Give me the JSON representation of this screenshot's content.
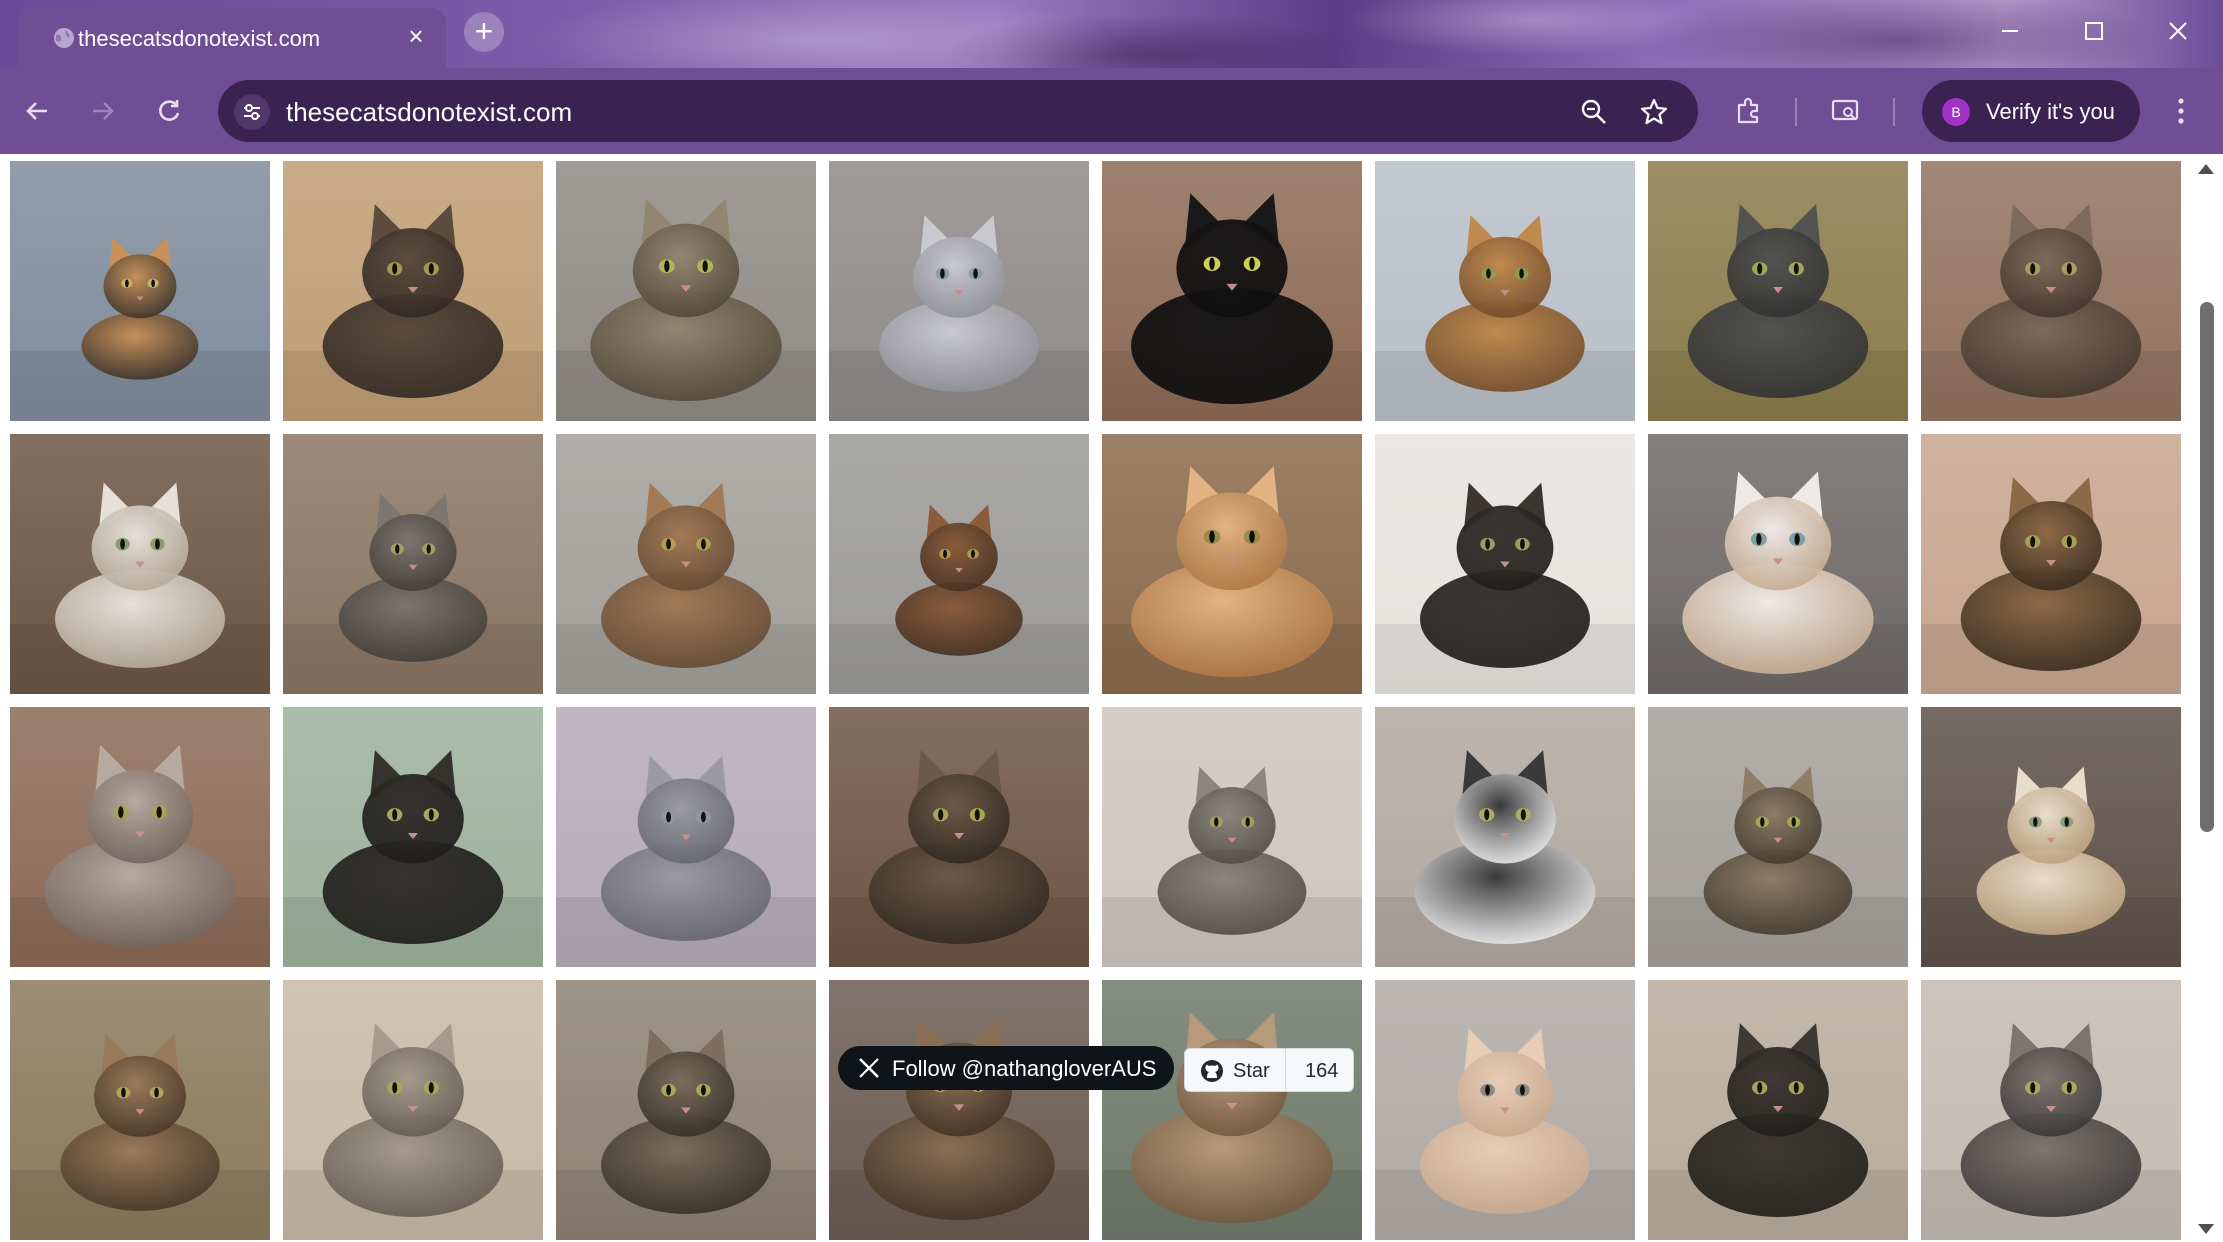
{
  "browser": {
    "tab": {
      "title": "thesecatsdonotexist.com",
      "favicon": "globe-icon"
    },
    "address_bar": {
      "url": "thesecatsdonotexist.com"
    },
    "profile_button": {
      "avatar_letter": "B",
      "label": "Verify it's you"
    }
  },
  "colors": {
    "frame": "#6f4e96",
    "omnibox": "#3a2350",
    "follow_badge": "#0f1419",
    "github_badge": "#f6f8fa"
  },
  "gallery": {
    "columns": 8,
    "rows": 4,
    "cats": [
      {
        "bg": "#7f8c9c",
        "fur": "#c8915b",
        "dark": "#2d2721",
        "eye": "#c8b36a",
        "size": 0.55
      },
      {
        "bg": "#bf9d73",
        "fur": "#5b4c3e",
        "dark": "#2d2420",
        "eye": "#a09a4a",
        "size": 0.85
      },
      {
        "bg": "#8f8a84",
        "fur": "#938671",
        "dark": "#4c4033",
        "eye": "#b2b25a",
        "size": 0.9
      },
      {
        "bg": "#8e8a88",
        "fur": "#c8c8cf",
        "dark": "#8a8a94",
        "eye": "#8aa0a8",
        "size": 0.75
      },
      {
        "bg": "#8d6b56",
        "fur": "#1a1919",
        "dark": "#0c0c0c",
        "eye": "#c9cf52",
        "size": 0.95
      },
      {
        "bg": "#b8bfc8",
        "fur": "#c08a4e",
        "dark": "#6b4424",
        "eye": "#8f9a50",
        "size": 0.75
      },
      {
        "bg": "#8b7c4c",
        "fur": "#535352",
        "dark": "#2e2e2d",
        "eye": "#a1a85a",
        "size": 0.85
      },
      {
        "bg": "#92725e",
        "fur": "#7e6a5a",
        "dark": "#3d3129",
        "eye": "#a89a60",
        "size": 0.85
      },
      {
        "bg": "#6c5645",
        "fur": "#e6e0d8",
        "dark": "#b0a393",
        "eye": "#8aa06a",
        "size": 0.8
      },
      {
        "bg": "#8a7562",
        "fur": "#7d7670",
        "dark": "#3c3732",
        "eye": "#a4a05c",
        "size": 0.7
      },
      {
        "bg": "#a29f9a",
        "fur": "#a27a55",
        "dark": "#5d4430",
        "eye": "#b0a04e",
        "size": 0.8
      },
      {
        "bg": "#9b9a97",
        "fur": "#8a5c3c",
        "dark": "#3e2a1c",
        "eye": "#a89a50",
        "size": 0.6
      },
      {
        "bg": "#8a6a4c",
        "fur": "#e2b383",
        "dark": "#a8703f",
        "eye": "#9a8c48",
        "size": 0.95
      },
      {
        "bg": "#e6e3df",
        "fur": "#3b3632",
        "dark": "#1c1a18",
        "eye": "#9aa15c",
        "size": 0.8
      },
      {
        "bg": "#6e6966",
        "fur": "#ede9e6",
        "dark": "#c2a487",
        "eye": "#7fa0a8",
        "size": 0.9
      },
      {
        "bg": "#c7a58e",
        "fur": "#8d6a47",
        "dark": "#2f2418",
        "eye": "#a8a050",
        "size": 0.85
      },
      {
        "bg": "#8b6a55",
        "fur": "#b6a9a0",
        "dark": "#6a5d55",
        "eye": "#a6a35a",
        "size": 0.9
      },
      {
        "bg": "#9cb19c",
        "fur": "#36332f",
        "dark": "#1b1a18",
        "eye": "#a6a85c",
        "size": 0.85
      },
      {
        "bg": "#b6aab8",
        "fur": "#9a9aa0",
        "dark": "#60606a",
        "eye": "#8c9a9e",
        "size": 0.8
      },
      {
        "bg": "#6e5544",
        "fur": "#6c5a48",
        "dark": "#2b231c",
        "eye": "#a8a458",
        "size": 0.85
      },
      {
        "bg": "#cfc6bd",
        "fur": "#8c8680",
        "dark": "#4a4540",
        "eye": "#a8a05a",
        "size": 0.7
      },
      {
        "bg": "#b2a89f",
        "fur": "#3a3a3c",
        "dark": "#ffffff",
        "eye": "#b2ac60",
        "size": 0.85
      },
      {
        "bg": "#a49f9a",
        "fur": "#8d7c66",
        "dark": "#3b3227",
        "eye": "#a4a856",
        "size": 0.7
      },
      {
        "bg": "#5e5148",
        "fur": "#e8dccb",
        "dark": "#b89a73",
        "eye": "#8aa07a",
        "size": 0.7
      },
      {
        "bg": "#8a7a5c",
        "fur": "#9a7a5a",
        "dark": "#3f3022",
        "eye": "#b0a456",
        "size": 0.75
      },
      {
        "bg": "#c8b9a7",
        "fur": "#a69a8e",
        "dark": "#5e544a",
        "eye": "#a8a458",
        "size": 0.85
      },
      {
        "bg": "#8e8174",
        "fur": "#7c6d5e",
        "dark": "#2f2820",
        "eye": "#a8aa58",
        "size": 0.8
      },
      {
        "bg": "#6b5c52",
        "fur": "#8a6f55",
        "dark": "#3a2c20",
        "eye": "#a89a50",
        "size": 0.9
      },
      {
        "bg": "#6e7a6a",
        "fur": "#b79a7c",
        "dark": "#6a5038",
        "eye": "#9aa050",
        "size": 0.95
      },
      {
        "bg": "#b0aaa6",
        "fur": "#e8cdb6",
        "dark": "#c4a48a",
        "eye": "#8a8a80",
        "size": 0.8
      },
      {
        "bg": "#b8ab9c",
        "fur": "#3e3935",
        "dark": "#1d1a17",
        "eye": "#a4a458",
        "size": 0.85
      },
      {
        "bg": "#c4bbb1",
        "fur": "#7d766f",
        "dark": "#333030",
        "eye": "#a8aa58",
        "size": 0.85
      }
    ]
  },
  "badges": {
    "follow_label": "Follow @nathangloverAUS",
    "github_star_label": "Star",
    "github_star_count": "164"
  }
}
